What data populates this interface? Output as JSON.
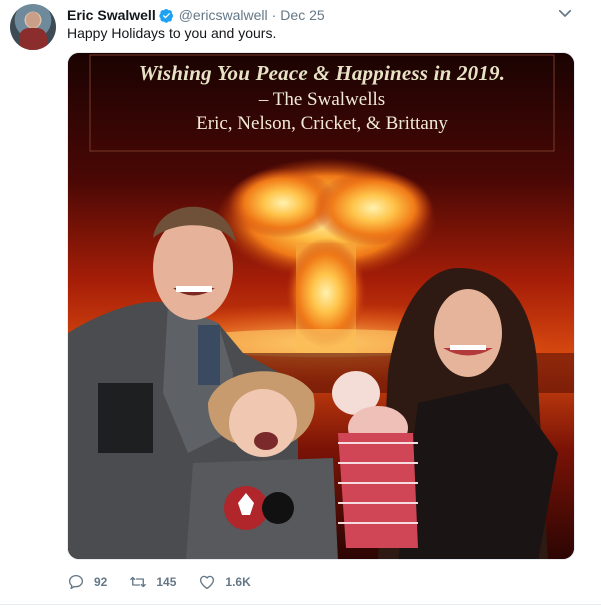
{
  "tweet": {
    "author_name": "Eric Swalwell",
    "handle": "@ericswalwell",
    "separator": "·",
    "date": "Dec 25",
    "text": "Happy Holidays to you and yours."
  },
  "card": {
    "line1": "Wishing You Peace & Happiness in 2019.",
    "line2": "– The Swalwells",
    "line3": "Eric, Nelson, Cricket, & Brittany"
  },
  "actions": {
    "replies": "92",
    "retweets": "145",
    "likes": "1.6K"
  },
  "icons": {
    "verified": "verified-badge-icon",
    "menu": "chevron-down-icon",
    "reply": "reply-icon",
    "retweet": "retweet-icon",
    "like": "heart-icon"
  },
  "colors": {
    "verified": "#1da1f2",
    "secondary_text": "#657786",
    "explosion": "#ffb23a"
  }
}
